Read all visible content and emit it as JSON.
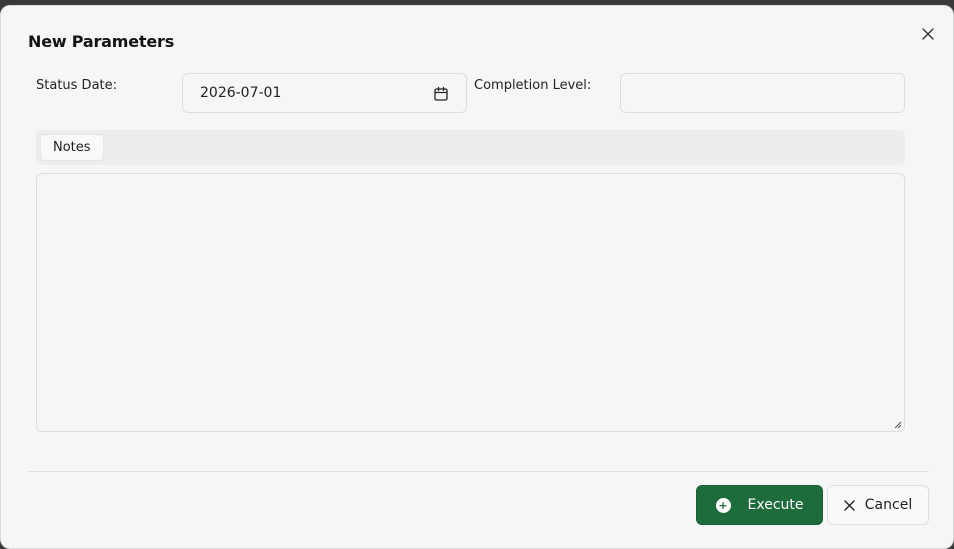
{
  "dialog": {
    "title": "New Parameters",
    "close_icon": "close-icon"
  },
  "form": {
    "status_date_label": "Status Date:",
    "status_date_value": "2026-07-01",
    "calendar_icon": "calendar-icon",
    "completion_level_label": "Completion Level:",
    "completion_level_value": ""
  },
  "tabs": [
    {
      "label": "Notes",
      "active": true
    }
  ],
  "notes": {
    "value": ""
  },
  "footer": {
    "execute_label": "Execute",
    "execute_icon": "plus-circle-icon",
    "cancel_label": "Cancel",
    "cancel_icon": "close-icon"
  },
  "colors": {
    "primary": "#1e6b3c",
    "background": "#f5f7f6"
  }
}
